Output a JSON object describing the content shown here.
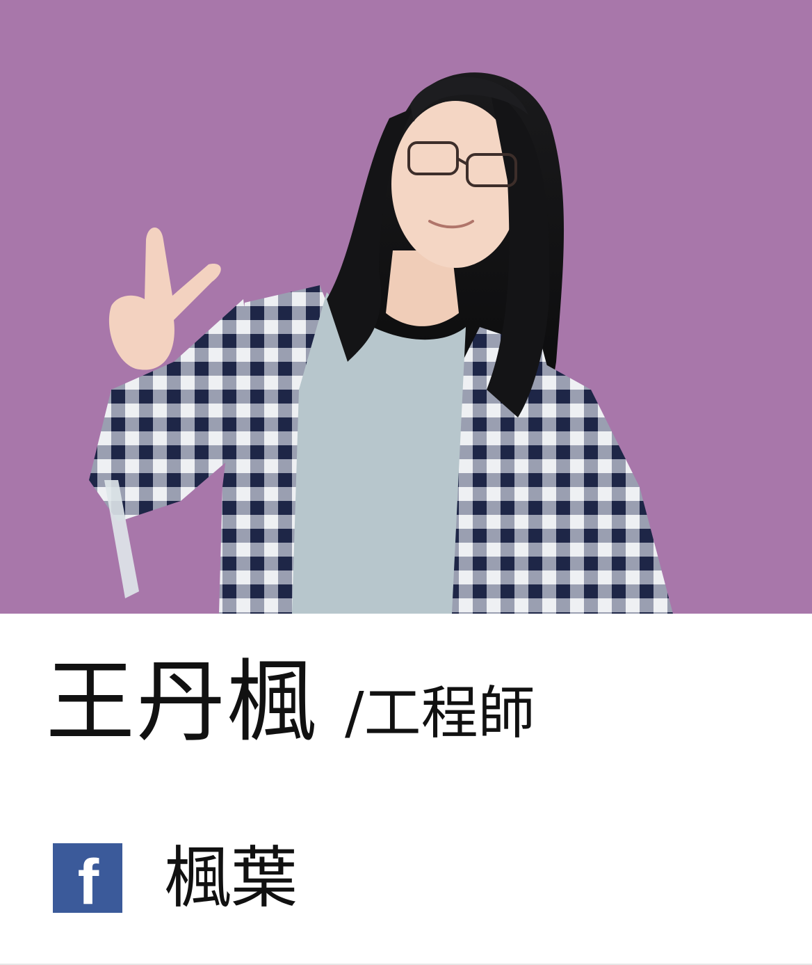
{
  "profile": {
    "name": "王丹楓",
    "role": "/工程師"
  },
  "social": {
    "icon": "facebook-icon",
    "icon_letter": "f",
    "label": "楓葉"
  },
  "colors": {
    "photo_background": "#a877aa",
    "facebook_blue": "#3b5a9a",
    "text": "#111111"
  }
}
